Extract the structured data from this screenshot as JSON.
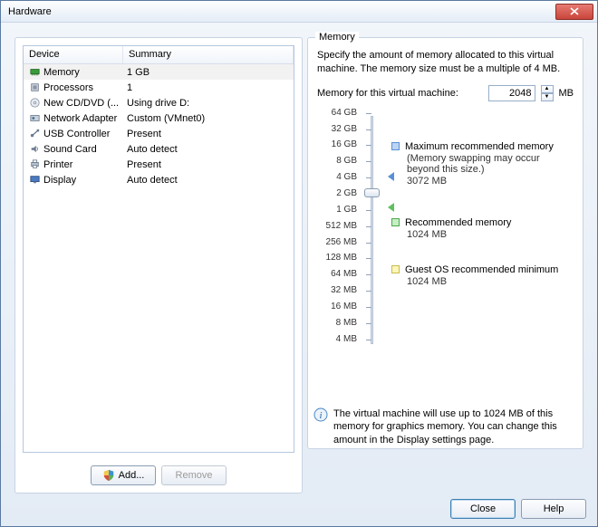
{
  "window": {
    "title": "Hardware"
  },
  "table": {
    "headers": {
      "device": "Device",
      "summary": "Summary"
    },
    "rows": [
      {
        "icon": "memory",
        "device": "Memory",
        "summary": "1 GB",
        "selected": true
      },
      {
        "icon": "cpu",
        "device": "Processors",
        "summary": "1"
      },
      {
        "icon": "cd",
        "device": "New CD/DVD (...",
        "summary": "Using drive D:"
      },
      {
        "icon": "nic",
        "device": "Network Adapter",
        "summary": "Custom (VMnet0)"
      },
      {
        "icon": "usb",
        "device": "USB Controller",
        "summary": "Present"
      },
      {
        "icon": "sound",
        "device": "Sound Card",
        "summary": "Auto detect"
      },
      {
        "icon": "printer",
        "device": "Printer",
        "summary": "Present"
      },
      {
        "icon": "display",
        "device": "Display",
        "summary": "Auto detect"
      }
    ]
  },
  "buttons": {
    "add": "Add...",
    "remove": "Remove",
    "close": "Close",
    "help": "Help"
  },
  "memory": {
    "legend": "Memory",
    "desc": "Specify the amount of memory allocated to this virtual machine. The memory size must be a multiple of 4 MB.",
    "input_label": "Memory for this virtual machine:",
    "value": "2048",
    "unit": "MB",
    "ticks": [
      "64 GB",
      "32 GB",
      "16 GB",
      "8 GB",
      "4 GB",
      "2 GB",
      "1 GB",
      "512 MB",
      "256 MB",
      "128 MB",
      "64 MB",
      "32 MB",
      "16 MB",
      "8 MB",
      "4 MB"
    ],
    "max_rec": {
      "label": "Maximum recommended memory",
      "note": "(Memory swapping may occur beyond this size.)",
      "value": "3072 MB"
    },
    "rec": {
      "label": "Recommended memory",
      "value": "1024 MB"
    },
    "guest": {
      "label": "Guest OS recommended minimum",
      "value": "1024 MB"
    },
    "info": "The virtual machine will use up to 1024 MB of this memory for graphics memory. You can change this amount in the Display settings page."
  }
}
